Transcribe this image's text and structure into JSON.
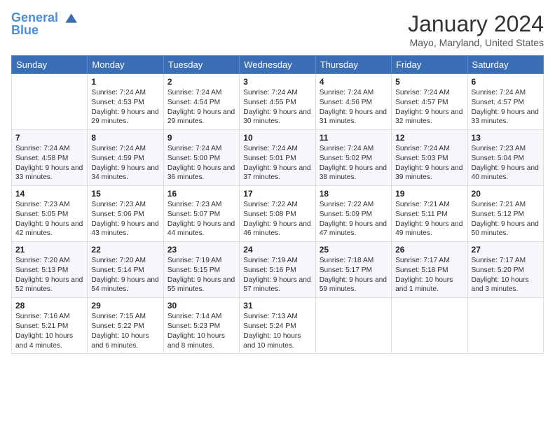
{
  "header": {
    "logo_line1": "General",
    "logo_line2": "Blue",
    "month": "January 2024",
    "location": "Mayo, Maryland, United States"
  },
  "columns": [
    "Sunday",
    "Monday",
    "Tuesday",
    "Wednesday",
    "Thursday",
    "Friday",
    "Saturday"
  ],
  "weeks": [
    [
      {
        "day": "",
        "sunrise": "",
        "sunset": "",
        "daylight": ""
      },
      {
        "day": "1",
        "sunrise": "Sunrise: 7:24 AM",
        "sunset": "Sunset: 4:53 PM",
        "daylight": "Daylight: 9 hours and 29 minutes."
      },
      {
        "day": "2",
        "sunrise": "Sunrise: 7:24 AM",
        "sunset": "Sunset: 4:54 PM",
        "daylight": "Daylight: 9 hours and 29 minutes."
      },
      {
        "day": "3",
        "sunrise": "Sunrise: 7:24 AM",
        "sunset": "Sunset: 4:55 PM",
        "daylight": "Daylight: 9 hours and 30 minutes."
      },
      {
        "day": "4",
        "sunrise": "Sunrise: 7:24 AM",
        "sunset": "Sunset: 4:56 PM",
        "daylight": "Daylight: 9 hours and 31 minutes."
      },
      {
        "day": "5",
        "sunrise": "Sunrise: 7:24 AM",
        "sunset": "Sunset: 4:57 PM",
        "daylight": "Daylight: 9 hours and 32 minutes."
      },
      {
        "day": "6",
        "sunrise": "Sunrise: 7:24 AM",
        "sunset": "Sunset: 4:57 PM",
        "daylight": "Daylight: 9 hours and 33 minutes."
      }
    ],
    [
      {
        "day": "7",
        "sunrise": "Sunrise: 7:24 AM",
        "sunset": "Sunset: 4:58 PM",
        "daylight": "Daylight: 9 hours and 33 minutes."
      },
      {
        "day": "8",
        "sunrise": "Sunrise: 7:24 AM",
        "sunset": "Sunset: 4:59 PM",
        "daylight": "Daylight: 9 hours and 34 minutes."
      },
      {
        "day": "9",
        "sunrise": "Sunrise: 7:24 AM",
        "sunset": "Sunset: 5:00 PM",
        "daylight": "Daylight: 9 hours and 36 minutes."
      },
      {
        "day": "10",
        "sunrise": "Sunrise: 7:24 AM",
        "sunset": "Sunset: 5:01 PM",
        "daylight": "Daylight: 9 hours and 37 minutes."
      },
      {
        "day": "11",
        "sunrise": "Sunrise: 7:24 AM",
        "sunset": "Sunset: 5:02 PM",
        "daylight": "Daylight: 9 hours and 38 minutes."
      },
      {
        "day": "12",
        "sunrise": "Sunrise: 7:24 AM",
        "sunset": "Sunset: 5:03 PM",
        "daylight": "Daylight: 9 hours and 39 minutes."
      },
      {
        "day": "13",
        "sunrise": "Sunrise: 7:23 AM",
        "sunset": "Sunset: 5:04 PM",
        "daylight": "Daylight: 9 hours and 40 minutes."
      }
    ],
    [
      {
        "day": "14",
        "sunrise": "Sunrise: 7:23 AM",
        "sunset": "Sunset: 5:05 PM",
        "daylight": "Daylight: 9 hours and 42 minutes."
      },
      {
        "day": "15",
        "sunrise": "Sunrise: 7:23 AM",
        "sunset": "Sunset: 5:06 PM",
        "daylight": "Daylight: 9 hours and 43 minutes."
      },
      {
        "day": "16",
        "sunrise": "Sunrise: 7:23 AM",
        "sunset": "Sunset: 5:07 PM",
        "daylight": "Daylight: 9 hours and 44 minutes."
      },
      {
        "day": "17",
        "sunrise": "Sunrise: 7:22 AM",
        "sunset": "Sunset: 5:08 PM",
        "daylight": "Daylight: 9 hours and 46 minutes."
      },
      {
        "day": "18",
        "sunrise": "Sunrise: 7:22 AM",
        "sunset": "Sunset: 5:09 PM",
        "daylight": "Daylight: 9 hours and 47 minutes."
      },
      {
        "day": "19",
        "sunrise": "Sunrise: 7:21 AM",
        "sunset": "Sunset: 5:11 PM",
        "daylight": "Daylight: 9 hours and 49 minutes."
      },
      {
        "day": "20",
        "sunrise": "Sunrise: 7:21 AM",
        "sunset": "Sunset: 5:12 PM",
        "daylight": "Daylight: 9 hours and 50 minutes."
      }
    ],
    [
      {
        "day": "21",
        "sunrise": "Sunrise: 7:20 AM",
        "sunset": "Sunset: 5:13 PM",
        "daylight": "Daylight: 9 hours and 52 minutes."
      },
      {
        "day": "22",
        "sunrise": "Sunrise: 7:20 AM",
        "sunset": "Sunset: 5:14 PM",
        "daylight": "Daylight: 9 hours and 54 minutes."
      },
      {
        "day": "23",
        "sunrise": "Sunrise: 7:19 AM",
        "sunset": "Sunset: 5:15 PM",
        "daylight": "Daylight: 9 hours and 55 minutes."
      },
      {
        "day": "24",
        "sunrise": "Sunrise: 7:19 AM",
        "sunset": "Sunset: 5:16 PM",
        "daylight": "Daylight: 9 hours and 57 minutes."
      },
      {
        "day": "25",
        "sunrise": "Sunrise: 7:18 AM",
        "sunset": "Sunset: 5:17 PM",
        "daylight": "Daylight: 9 hours and 59 minutes."
      },
      {
        "day": "26",
        "sunrise": "Sunrise: 7:17 AM",
        "sunset": "Sunset: 5:18 PM",
        "daylight": "Daylight: 10 hours and 1 minute."
      },
      {
        "day": "27",
        "sunrise": "Sunrise: 7:17 AM",
        "sunset": "Sunset: 5:20 PM",
        "daylight": "Daylight: 10 hours and 3 minutes."
      }
    ],
    [
      {
        "day": "28",
        "sunrise": "Sunrise: 7:16 AM",
        "sunset": "Sunset: 5:21 PM",
        "daylight": "Daylight: 10 hours and 4 minutes."
      },
      {
        "day": "29",
        "sunrise": "Sunrise: 7:15 AM",
        "sunset": "Sunset: 5:22 PM",
        "daylight": "Daylight: 10 hours and 6 minutes."
      },
      {
        "day": "30",
        "sunrise": "Sunrise: 7:14 AM",
        "sunset": "Sunset: 5:23 PM",
        "daylight": "Daylight: 10 hours and 8 minutes."
      },
      {
        "day": "31",
        "sunrise": "Sunrise: 7:13 AM",
        "sunset": "Sunset: 5:24 PM",
        "daylight": "Daylight: 10 hours and 10 minutes."
      },
      {
        "day": "",
        "sunrise": "",
        "sunset": "",
        "daylight": ""
      },
      {
        "day": "",
        "sunrise": "",
        "sunset": "",
        "daylight": ""
      },
      {
        "day": "",
        "sunrise": "",
        "sunset": "",
        "daylight": ""
      }
    ]
  ]
}
